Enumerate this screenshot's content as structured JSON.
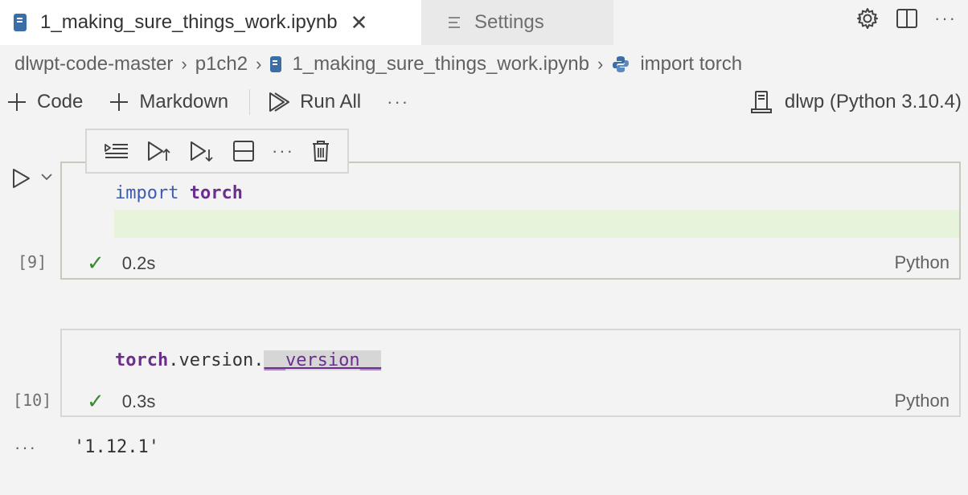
{
  "tabs": {
    "active": {
      "label": "1_making_sure_things_work.ipynb",
      "close": "✕"
    },
    "inactive": {
      "label": "Settings"
    }
  },
  "breadcrumb": {
    "items": [
      "dlwpt-code-master",
      "p1ch2",
      "1_making_sure_things_work.ipynb",
      "import torch"
    ],
    "separator": "›"
  },
  "toolbar": {
    "code_label": "Code",
    "markdown_label": "Markdown",
    "run_all_label": "Run All",
    "more": "···"
  },
  "kernel": {
    "label": "dlwp (Python 3.10.4)"
  },
  "cells": [
    {
      "code": {
        "keyword": "import",
        "module": "torch"
      },
      "exec_count": "[9]",
      "duration": "0.2s",
      "language": "Python"
    },
    {
      "code": {
        "module": "torch",
        "rest": ".version.",
        "attr": "__version__"
      },
      "exec_count": "[10]",
      "duration": "0.3s",
      "language": "Python",
      "output": "'1.12.1'"
    }
  ],
  "cell_toolbar": {
    "more": "···"
  },
  "output_more": "···",
  "colors": {
    "accent": "#3d5bb0",
    "module": "#6b2e8e",
    "success": "#388a34",
    "line_highlight": "#e7f3da"
  }
}
